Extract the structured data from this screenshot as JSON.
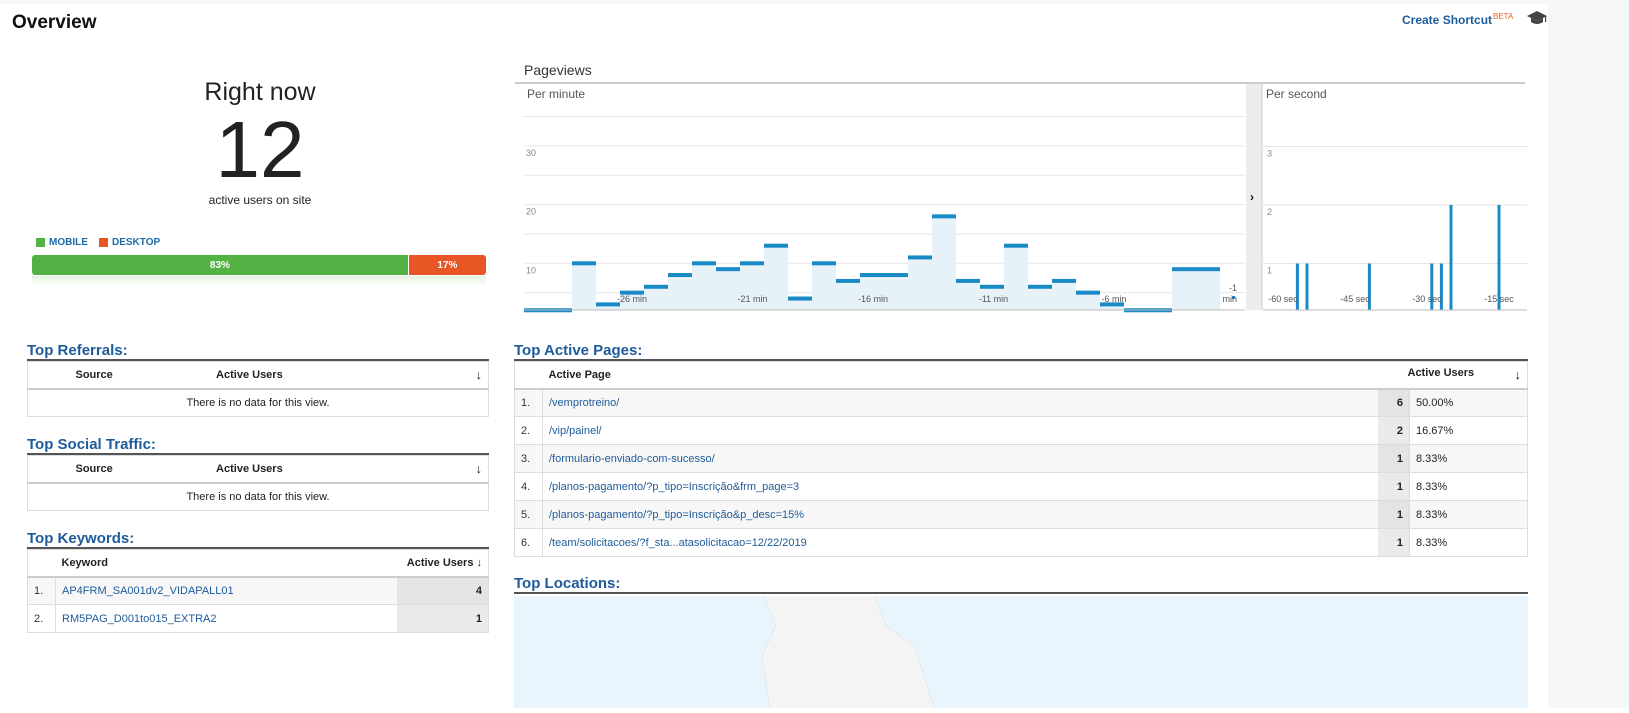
{
  "header": {
    "title": "Overview",
    "create_shortcut": "Create Shortcut",
    "beta": "BETA",
    "icon": "graduation-cap-icon"
  },
  "right_now": {
    "label": "Right now",
    "count": "12",
    "sub": "active users on site",
    "legend": [
      {
        "label": "MOBILE",
        "color": "#54b244"
      },
      {
        "label": "DESKTOP",
        "color": "#e95625"
      }
    ],
    "split": [
      {
        "label": "83%",
        "value": 83,
        "color": "#54b244"
      },
      {
        "label": "17%",
        "value": 17,
        "color": "#e95625"
      }
    ]
  },
  "pageviews": {
    "title": "Pageviews",
    "toggle_icon": "chevron-right-icon"
  },
  "chart_data": [
    {
      "type": "bar",
      "title": "Per minute",
      "ylim": [
        0,
        35
      ],
      "yticks": [
        "10",
        "20",
        "30"
      ],
      "x": [
        -30,
        -29,
        -28,
        -27,
        -26,
        -25,
        -24,
        -23,
        -22,
        -21,
        -20,
        -19,
        -18,
        -17,
        -16,
        -15,
        -14,
        -13,
        -12,
        -11,
        -10,
        -9,
        -8,
        -7,
        -6,
        -5,
        -4,
        -3,
        -2,
        -1
      ],
      "values": [
        2,
        2,
        10,
        3,
        5,
        6,
        8,
        10,
        9,
        10,
        13,
        4,
        10,
        7,
        8,
        8,
        11,
        18,
        7,
        6,
        13,
        6,
        7,
        5,
        3,
        2,
        2,
        9,
        9,
        0
      ],
      "xticks": [
        "-26 min",
        "-21 min",
        "-16 min",
        "-11 min",
        "-6 min",
        "-1 min"
      ]
    },
    {
      "type": "bar",
      "title": "Per second",
      "ylim": [
        0,
        3.5
      ],
      "yticks": [
        "1",
        "2",
        "3"
      ],
      "x": [
        -57,
        -55,
        -42,
        -29,
        -27,
        -25,
        -15
      ],
      "values": [
        1,
        1,
        1,
        1,
        1,
        2,
        2
      ],
      "xticks": [
        "-60 sec",
        "-45 sec",
        "-30 sec",
        "-15 sec"
      ]
    }
  ],
  "referrals": {
    "title": "Top Referrals:",
    "col_source": "Source",
    "col_users": "Active Users",
    "empty": "There is no data for this view."
  },
  "social": {
    "title": "Top Social Traffic:",
    "col_source": "Source",
    "col_users": "Active Users",
    "empty": "There is no data for this view."
  },
  "keywords": {
    "title": "Top Keywords:",
    "col_keyword": "Keyword",
    "col_users": "Active Users",
    "rows": [
      {
        "n": "1.",
        "k": "AP4FRM_SA001dv2_VIDAPALL01",
        "v": "4"
      },
      {
        "n": "2.",
        "k": "RM5PAG_D001to015_EXTRA2",
        "v": "1"
      }
    ]
  },
  "pages": {
    "title": "Top Active Pages:",
    "col_page": "Active Page",
    "col_users": "Active Users",
    "rows": [
      {
        "n": "1.",
        "page": "/vemprotreino/",
        "v": "6",
        "p": "50.00%"
      },
      {
        "n": "2.",
        "page": "/vip/painel/",
        "v": "2",
        "p": "16.67%"
      },
      {
        "n": "3.",
        "page": "/formulario-enviado-com-sucesso/",
        "v": "1",
        "p": "8.33%"
      },
      {
        "n": "4.",
        "page": "/planos-pagamento/?p_tipo=Inscrição&frm_page=3",
        "v": "1",
        "p": "8.33%"
      },
      {
        "n": "5.",
        "page": "/planos-pagamento/?p_tipo=Inscrição&p_desc=15%",
        "v": "1",
        "p": "8.33%"
      },
      {
        "n": "6.",
        "page": "/team/solicitacoes/?f_sta...atasolicitacao=12/22/2019",
        "v": "1",
        "p": "8.33%"
      }
    ]
  },
  "locations": {
    "title": "Top Locations:"
  }
}
